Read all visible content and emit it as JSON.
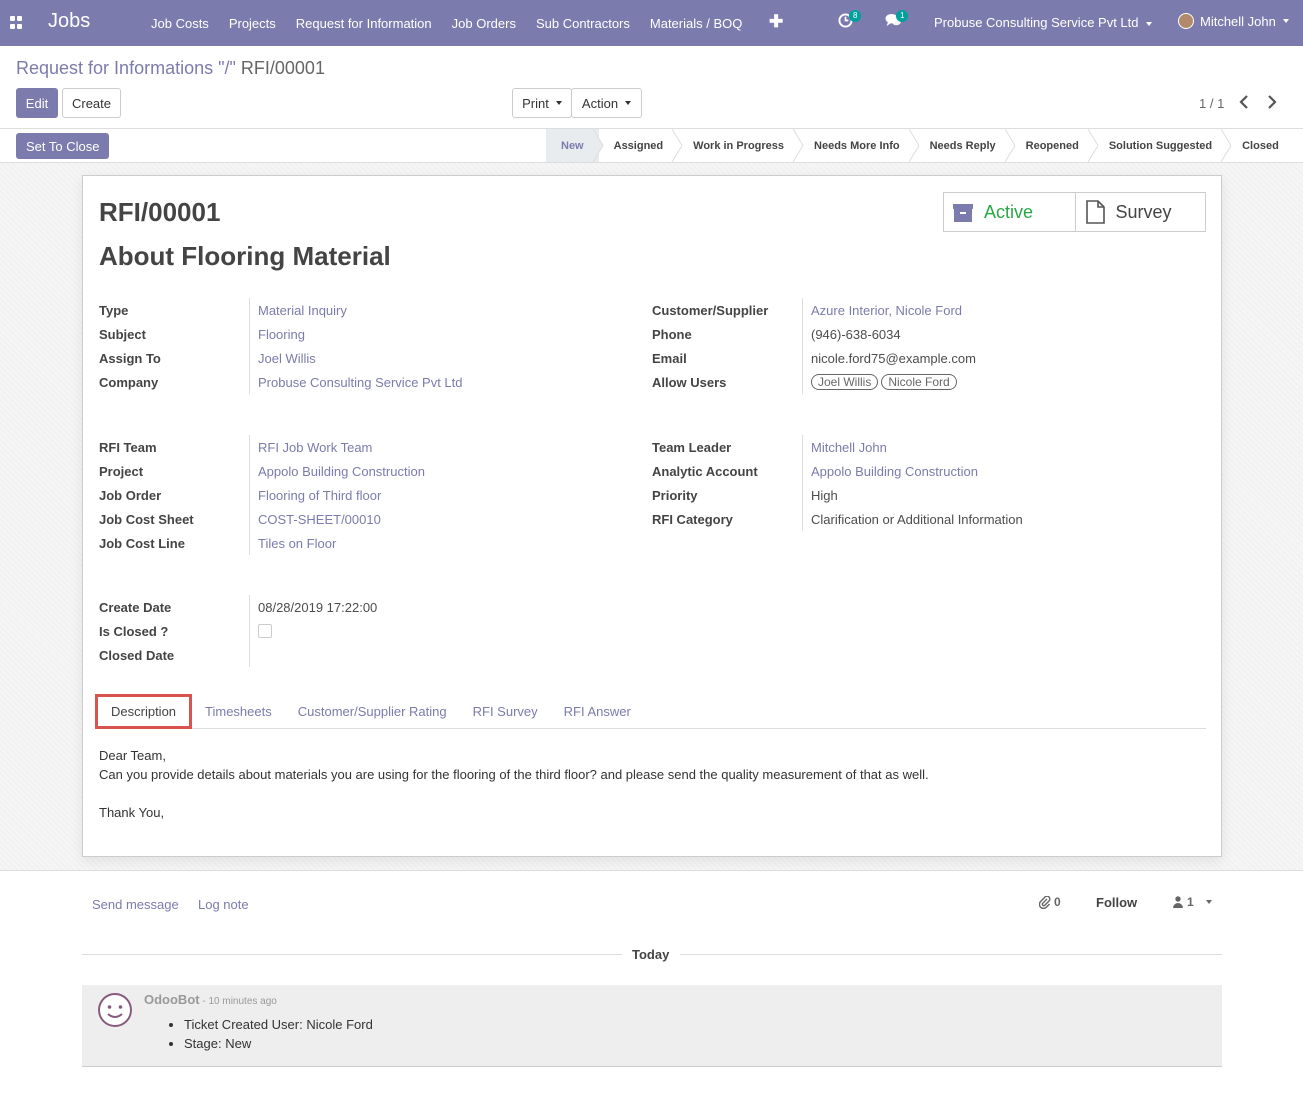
{
  "navbar": {
    "brand": "Jobs",
    "menu": [
      "Job Costs",
      "Projects",
      "Request for Information",
      "Job Orders",
      "Sub Contractors",
      "Materials / BOQ"
    ],
    "activity_count": "8",
    "message_count": "1",
    "company": "Probuse Consulting Service Pvt Ltd",
    "user": "Mitchell John"
  },
  "breadcrumb": {
    "parent": "Request for Informations",
    "separator": " \"/\" ",
    "current": "RFI/00001"
  },
  "buttons": {
    "edit": "Edit",
    "create": "Create",
    "print": "Print",
    "action": "Action",
    "set_to_close": "Set To Close"
  },
  "pager": {
    "value": "1 / 1"
  },
  "stages": [
    "New",
    "Assigned",
    "Work in Progress",
    "Needs More Info",
    "Needs Reply",
    "Reopened",
    "Solution Suggested",
    "Closed"
  ],
  "active_stage": "New",
  "stat_buttons": {
    "active": "Active",
    "survey": "Survey"
  },
  "record": {
    "reference": "RFI/00001",
    "title": "About Flooring Material"
  },
  "left_group1": [
    {
      "label": "Type",
      "value": "Material Inquiry"
    },
    {
      "label": "Subject",
      "value": "Flooring"
    },
    {
      "label": "Assign To",
      "value": "Joel Willis"
    },
    {
      "label": "Company",
      "value": "Probuse Consulting Service Pvt Ltd"
    }
  ],
  "right_group1": {
    "customer_label": "Customer/Supplier",
    "customer": "Azure Interior, Nicole Ford",
    "phone_label": "Phone",
    "phone": "(946)-638-6034",
    "email_label": "Email",
    "email": "nicole.ford75@example.com",
    "allow_users_label": "Allow Users",
    "allow_users": [
      "Joel Willis",
      "Nicole Ford"
    ]
  },
  "left_group2": [
    {
      "label": "RFI Team",
      "value": "RFI Job Work Team"
    },
    {
      "label": "Project",
      "value": "Appolo Building Construction"
    },
    {
      "label": "Job Order",
      "value": "Flooring of Third floor"
    },
    {
      "label": "Job Cost Sheet",
      "value": "COST-SHEET/00010"
    },
    {
      "label": "Job Cost Line",
      "value": "Tiles on Floor"
    }
  ],
  "right_group2": [
    {
      "label": "Team Leader",
      "value": "Mitchell John"
    },
    {
      "label": "Analytic Account",
      "value": "Appolo Building Construction"
    },
    {
      "label": "Priority",
      "value": "High"
    },
    {
      "label": "RFI Category",
      "value": "Clarification or Additional Information"
    }
  ],
  "dates": {
    "create_label": "Create Date",
    "create": "08/28/2019 17:22:00",
    "is_closed_label": "Is Closed ?",
    "closed_label": "Closed Date"
  },
  "tabs": [
    "Description",
    "Timesheets",
    "Customer/Supplier Rating",
    "RFI Survey",
    "RFI Answer"
  ],
  "description": {
    "line1": "Dear Team,",
    "line2": "Can you provide details about materials you are using for the flooring of the third floor? and please send the quality measurement of that as well.",
    "line3": "Thank You,"
  },
  "chatter": {
    "send_message": "Send message",
    "log_note": "Log note",
    "attachments": "0",
    "follow": "Follow",
    "followers": "1",
    "day": "Today",
    "author": "OdooBot",
    "time": " - 10 minutes ago",
    "items": [
      "Ticket Created User: Nicole Ford",
      "Stage: New"
    ]
  },
  "colors": {
    "brand": "#7c7bad",
    "active_green": "#28a745",
    "highlight": "#d9534f"
  }
}
